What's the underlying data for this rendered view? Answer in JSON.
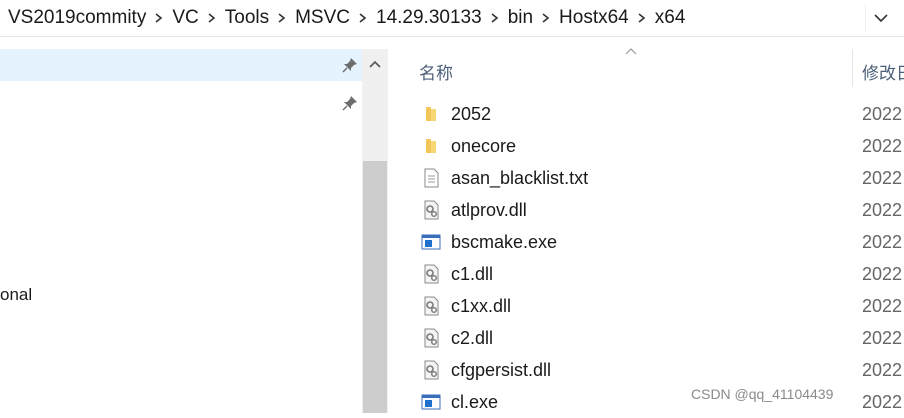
{
  "breadcrumb": [
    "VS2019commity",
    "VC",
    "Tools",
    "MSVC",
    "14.29.30133",
    "bin",
    "Hostx64",
    "x64"
  ],
  "nav": {
    "partial_label": "onal"
  },
  "list": {
    "columns": {
      "name": "名称",
      "date": "修改日"
    },
    "files": [
      {
        "name": "2052",
        "type": "folder",
        "date": "2022"
      },
      {
        "name": "onecore",
        "type": "folder",
        "date": "2022"
      },
      {
        "name": "asan_blacklist.txt",
        "type": "text",
        "date": "2022"
      },
      {
        "name": "atlprov.dll",
        "type": "dll",
        "date": "2022"
      },
      {
        "name": "bscmake.exe",
        "type": "exe",
        "date": "2022"
      },
      {
        "name": "c1.dll",
        "type": "dll",
        "date": "2022"
      },
      {
        "name": "c1xx.dll",
        "type": "dll",
        "date": "2022"
      },
      {
        "name": "c2.dll",
        "type": "dll",
        "date": "2022"
      },
      {
        "name": "cfgpersist.dll",
        "type": "dll",
        "date": "2022"
      },
      {
        "name": "cl.exe",
        "type": "exe",
        "date": "2022"
      }
    ]
  },
  "watermark": "CSDN @qq_41104439",
  "colors": {
    "selection": "#e5f3ff",
    "folder": "#f3c65b",
    "exe_blue": "#1f6fd0"
  }
}
